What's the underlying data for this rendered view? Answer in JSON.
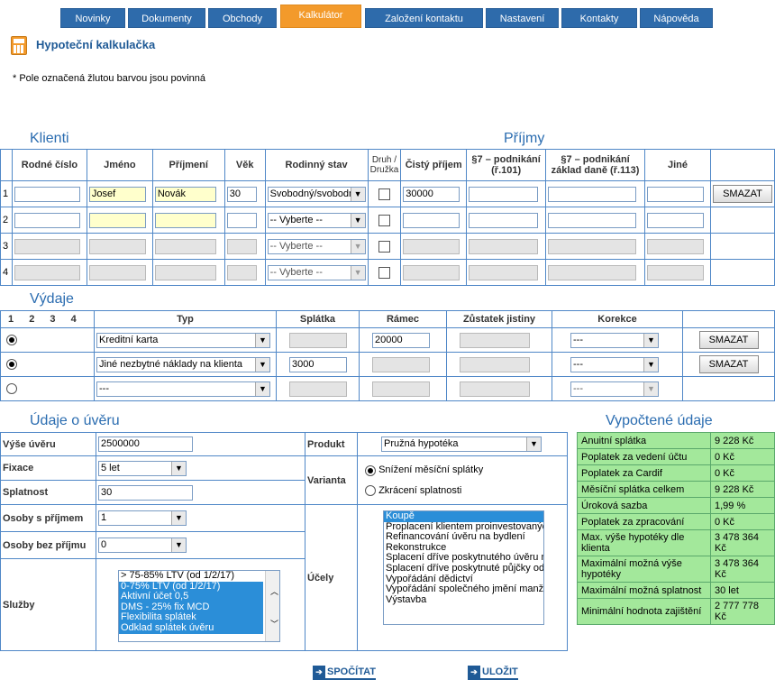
{
  "tabs": [
    "Novinky",
    "Dokumenty",
    "Obchody",
    "Kalkulátor",
    "Založení kontaktu",
    "Nastavení",
    "Kontakty",
    "Nápověda"
  ],
  "page": {
    "title": "Hypoteční kalkulačka",
    "note": "* Pole označená žlutou barvou jsou povinná"
  },
  "klienti": {
    "heading": "Klienti",
    "prijmy_heading": "Příjmy",
    "cols": [
      "Rodné číslo",
      "Jméno",
      "Příjmení",
      "Věk",
      "Rodinný stav",
      "Druh / Družka",
      "Čistý příjem",
      "§7 – podnikání (ř.101)",
      "§7 – podnikání základ daně (ř.113)",
      "Jiné"
    ],
    "rows": [
      {
        "n": "1",
        "jmeno": "Josef",
        "prijmeni": "Novák",
        "vek": "30",
        "stav": "Svobodný/svobodná",
        "prijem": "30000"
      },
      {
        "n": "2",
        "stav": "-- Vyberte --"
      },
      {
        "n": "3",
        "stav": "-- Vyberte --"
      },
      {
        "n": "4",
        "stav": "-- Vyberte --"
      }
    ],
    "delete": "SMAZAT"
  },
  "vydaje": {
    "heading": "Výdaje",
    "nums": [
      "1",
      "2",
      "3",
      "4"
    ],
    "cols": [
      "Typ",
      "Splátka",
      "Rámec",
      "Zůstatek jistiny",
      "Korekce"
    ],
    "rows": [
      {
        "typ": "Kreditní karta",
        "splatka": "",
        "ramec": "20000",
        "korekce": "---"
      },
      {
        "typ": "Jiné nezbytné náklady na klienta",
        "splatka": "3000",
        "ramec": "",
        "korekce": "---"
      },
      {
        "typ": "---",
        "splatka": "",
        "ramec": "",
        "korekce": "---"
      }
    ],
    "delete": "SMAZAT"
  },
  "uver": {
    "heading": "Údaje o úvěru",
    "vyse_label": "Výše úvěru",
    "vyse": "2500000",
    "fixace_label": "Fixace",
    "fixace": "5 let",
    "splatnost_label": "Splatnost",
    "splatnost": "30",
    "osoby_s_label": "Osoby s příjmem",
    "osoby_s": "1",
    "osoby_bez_label": "Osoby bez příjmu",
    "osoby_bez": "0",
    "sluzby_label": "Služby",
    "sluzby": [
      "> 75-85% LTV (od 1/2/17)",
      "0-75% LTV (od 1/2/17)",
      "Aktivní účet 0,5",
      "DMS - 25% fix MCD",
      "Flexibilita splátek",
      "Odklad splátek úvěru"
    ],
    "produkt_label": "Produkt",
    "produkt": "Pružná hypotéka",
    "varianta_label": "Varianta",
    "varianta1": "Snížení měsíční splátky",
    "varianta2": "Zkrácení splatnosti",
    "ucely_label": "Účely",
    "ucely": [
      "Koupě",
      "Proplacení klientem proinvestovaných",
      "Refinancování úvěru na bydlení",
      "Rekonstrukce",
      "Splacení dříve poskytnutého úvěru na",
      "Splacení dříve poskytnuté půjčky od",
      "Vypořádání dědictví",
      "Vypořádání společného jmění manž",
      "Výstavba"
    ]
  },
  "vypocet": {
    "heading": "Vypočtené údaje",
    "rows": [
      [
        "Anuitní splátka",
        "9 228 Kč"
      ],
      [
        "Poplatek za vedení účtu",
        "0 Kč"
      ],
      [
        "Poplatek za Cardif",
        "0 Kč"
      ],
      [
        "Měsíční splátka celkem",
        "9 228 Kč"
      ],
      [
        "Úroková sazba",
        "1,99 %"
      ],
      [
        "Poplatek za zpracování",
        "0 Kč"
      ],
      [
        "Max. výše hypotéky dle klienta",
        "3 478 364 Kč"
      ],
      [
        "Maximální možná výše hypotéky",
        "3 478 364 Kč"
      ],
      [
        "Maximální možná splatnost",
        "30 let"
      ],
      [
        "Minimální hodnota zajištění",
        "2 777 778 Kč"
      ]
    ]
  },
  "actions": {
    "spocitat": "SPOČÍTAT",
    "ulozit": "ULOŽIT"
  },
  "colors": {
    "tab": "#2e6bab",
    "tab_active": "#f39a2b",
    "result_bg": "#a3e89b",
    "border": "#4f87c7"
  }
}
